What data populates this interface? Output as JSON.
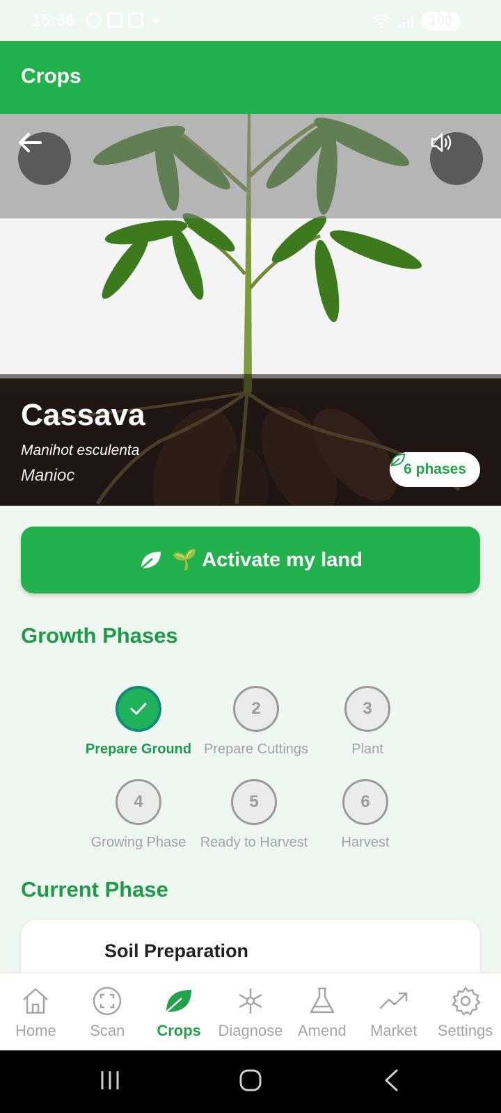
{
  "status_bar": {
    "time": "15:36",
    "battery": "100"
  },
  "appbar": {
    "title": "Crops"
  },
  "crop": {
    "name": "Cassava",
    "scientific_name": "Manihot esculenta",
    "local_name": "Manioc",
    "phases_badge": "6 phases"
  },
  "activate_button": {
    "label": "🌱 Activate my land"
  },
  "growth_phases": {
    "title": "Growth Phases",
    "items": [
      {
        "number": "✓",
        "label": "Prepare Ground",
        "state": "completed"
      },
      {
        "number": "2",
        "label": "Prepare Cuttings",
        "state": "pending"
      },
      {
        "number": "3",
        "label": "Plant",
        "state": "pending"
      },
      {
        "number": "4",
        "label": "Growing Phase",
        "state": "pending"
      },
      {
        "number": "5",
        "label": "Ready to Harvest",
        "state": "pending"
      },
      {
        "number": "6",
        "label": "Harvest",
        "state": "pending"
      }
    ]
  },
  "current_phase": {
    "title": "Current Phase",
    "card_title": "Soil Preparation"
  },
  "bottom_nav": {
    "items": [
      {
        "label": "Home",
        "icon": "home-icon"
      },
      {
        "label": "Scan",
        "icon": "scan-icon"
      },
      {
        "label": "Crops",
        "icon": "leaf-icon",
        "active": true
      },
      {
        "label": "Diagnose",
        "icon": "snowflake-icon"
      },
      {
        "label": "Amend",
        "icon": "flask-icon"
      },
      {
        "label": "Market",
        "icon": "trending-up-icon"
      },
      {
        "label": "Settings",
        "icon": "gear-icon"
      }
    ]
  },
  "colors": {
    "primary": "#22b14c",
    "accent_text": "#1f9a48",
    "completed": "#1fb25a"
  }
}
